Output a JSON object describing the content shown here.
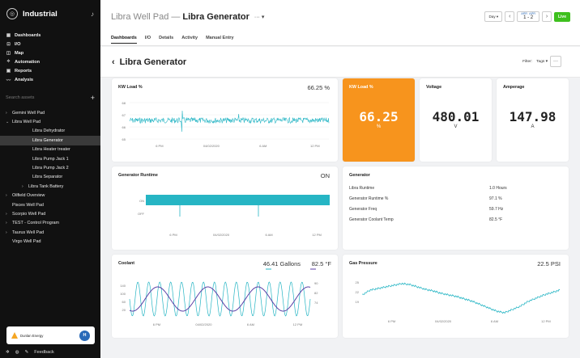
{
  "sidebar": {
    "app_title": "Industrial",
    "nav": [
      {
        "icon": "dashboard-icon",
        "glyph": "▦",
        "label": "Dashboards"
      },
      {
        "icon": "io-icon",
        "glyph": "⊡",
        "label": "I/O"
      },
      {
        "icon": "map-icon",
        "glyph": "◫",
        "label": "Map"
      },
      {
        "icon": "automation-icon",
        "glyph": "⟡",
        "label": "Automation"
      },
      {
        "icon": "reports-icon",
        "glyph": "▣",
        "label": "Reports"
      },
      {
        "icon": "analysis-icon",
        "glyph": "〰",
        "label": "Analysis"
      }
    ],
    "search_placeholder": "Search assets",
    "tree": [
      {
        "label": "Gemini Well Pad",
        "caret": "›",
        "level": 0
      },
      {
        "label": "Libra Well Pad",
        "caret": "⌄",
        "level": 0
      },
      {
        "label": "Libra Dehydrator",
        "caret": "",
        "level": 1
      },
      {
        "label": "Libra Generator",
        "caret": "",
        "level": 1,
        "selected": true
      },
      {
        "label": "Libra Heater treater",
        "caret": "",
        "level": 1
      },
      {
        "label": "Libra Pump Jack 1",
        "caret": "",
        "level": 1
      },
      {
        "label": "Libra Pump Jack 2",
        "caret": "",
        "level": 1
      },
      {
        "label": "Libra Separator",
        "caret": "",
        "level": 1
      },
      {
        "label": "Libra Tank Battery",
        "caret": "›",
        "level": 2
      },
      {
        "label": "Oilfield Overview",
        "caret": "›",
        "level": 0
      },
      {
        "label": "Pisces Well Pad",
        "caret": "",
        "level": 0
      },
      {
        "label": "Scorpio Well Pad",
        "caret": "›",
        "level": 0
      },
      {
        "label": "TEST - Control Program",
        "caret": "›",
        "level": 0
      },
      {
        "label": "Taurus Well Pad",
        "caret": "›",
        "level": 0
      },
      {
        "label": "Virgo Well Pad",
        "caret": "",
        "level": 0
      }
    ],
    "org_name": "Dunlan Energy",
    "avatar_initials": "H",
    "feedback_label": "Feedback"
  },
  "header": {
    "parent": "Libra Well Pad",
    "sep": "—",
    "asset": "Libra Generator",
    "menu": "··· ▾",
    "day_label": "Day ▾",
    "date_from_month": "APR",
    "date_from_day": "1",
    "date_to_month": "APR",
    "date_to_day": "2",
    "live_label": "Live",
    "tabs": [
      "Dashboards",
      "I/O",
      "Details",
      "Activity",
      "Manual Entry"
    ]
  },
  "subheader": {
    "back": "‹",
    "title": "Libra Generator",
    "filter_label": "Filter:",
    "tags_label": "Tags ▾",
    "more": "···"
  },
  "cards": {
    "kw_load": {
      "title": "KW Load %",
      "value": "66.25 %"
    },
    "kw_tile": {
      "title": "KW Load %",
      "value": "66.25",
      "unit": "%",
      "color": "#f7941d"
    },
    "voltage": {
      "title": "Voltage",
      "value": "480.01",
      "unit": "V"
    },
    "amperage": {
      "title": "Amperage",
      "value": "147.98",
      "unit": "A"
    },
    "runtime": {
      "title": "Generator Runtime",
      "value": "ON",
      "on_label": "ON",
      "off_label": "OFF"
    },
    "generator": {
      "title": "Generator",
      "rows": [
        {
          "label": "Libra Runtime",
          "value": "1.0 Hours"
        },
        {
          "label": "Generator Runtime %",
          "value": "97.1 %"
        },
        {
          "label": "Generator Freq",
          "value": "59.7 Hz"
        },
        {
          "label": "Generator Coolant Temp",
          "value": "82.5 °F"
        }
      ]
    },
    "coolant": {
      "title": "Coolant",
      "value1": "46.41 Gallons",
      "value2": "82.5 °F",
      "color1": "#26b5c4",
      "color2": "#5b3fa6"
    },
    "gas": {
      "title": "Gas Pressure",
      "value": "22.5 PSI"
    }
  },
  "axes": {
    "time_ticks": [
      "6 PM",
      "04/02/2020",
      "6 AM",
      "12 PM"
    ],
    "kw_y": [
      "68",
      "67",
      "66",
      "65"
    ],
    "coolant_left": [
      "140",
      "100",
      "60",
      "20"
    ],
    "coolant_right": [
      "90",
      "82",
      "74"
    ],
    "gas_y": [
      "25",
      "22",
      "19"
    ]
  },
  "colors": {
    "teal": "#26b5c4",
    "purple": "#5b3fa6",
    "live": "#3ec01e"
  }
}
